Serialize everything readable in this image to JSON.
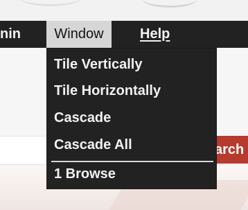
{
  "menubar": {
    "admin_label": "nin",
    "window_label": "Window",
    "help_label": "Help"
  },
  "window_menu": {
    "items": [
      {
        "label": "Tile Vertically"
      },
      {
        "label": "Tile Horizontally"
      },
      {
        "label": "Cascade"
      },
      {
        "label": "Cascade All"
      }
    ],
    "windows": [
      {
        "label": "1 Browse"
      }
    ]
  },
  "page": {
    "search_button_label": "arch"
  },
  "colors": {
    "menubar_bg": "#222222",
    "menu_active_bg": "#d6d6d6",
    "menu_text": "#f2f2f2",
    "search_button_bg": "#b63a2e"
  }
}
